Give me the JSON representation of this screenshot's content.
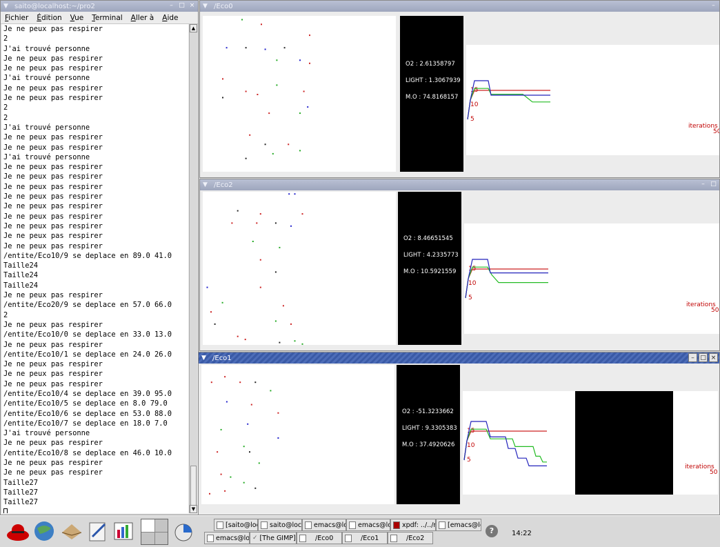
{
  "terminal": {
    "title": "saito@localhost:~/pro2",
    "menu": [
      "Fichier",
      "Édition",
      "Vue",
      "Terminal",
      "Aller à",
      "Aide"
    ],
    "lines": [
      "Je ne peux pas respirer",
      "2",
      "J'ai trouvé personne",
      "Je ne peux pas respirer",
      "Je ne peux pas respirer",
      "J'ai trouvé personne",
      "Je ne peux pas respirer",
      "Je ne peux pas respirer",
      "2",
      "2",
      "J'ai trouvé personne",
      "Je ne peux pas respirer",
      "Je ne peux pas respirer",
      "J'ai trouvé personne",
      "Je ne peux pas respirer",
      "Je ne peux pas respirer",
      "Je ne peux pas respirer",
      "Je ne peux pas respirer",
      "Je ne peux pas respirer",
      "Je ne peux pas respirer",
      "Je ne peux pas respirer",
      "Je ne peux pas respirer",
      "Je ne peux pas respirer",
      "/entite/Eco10/9 se deplace en 89.0 41.0",
      "Taille24",
      "Taille24",
      "Taille24",
      "Je ne peux pas respirer",
      "/entite/Eco20/9 se deplace en 57.0 66.0",
      "2",
      "Je ne peux pas respirer",
      "/entite/Eco10/0 se deplace en 33.0 13.0",
      "Je ne peux pas respirer",
      "/entite/Eco10/1 se deplace en 24.0 26.0",
      "Je ne peux pas respirer",
      "Je ne peux pas respirer",
      "Je ne peux pas respirer",
      "/entite/Eco10/4 se deplace en 39.0 95.0",
      "/entite/Eco10/5 se deplace en 8.0 79.0",
      "/entite/Eco10/6 se deplace en 53.0 88.0",
      "/entite/Eco10/7 se deplace en 18.0 7.0",
      "J'ai trouvé personne",
      "Je ne peux pas respirer",
      "/entite/Eco10/8 se deplace en 46.0 10.0",
      "Je ne peux pas respirer",
      "Je ne peux pas respirer",
      "Taille27",
      "Taille27",
      "Taille27"
    ]
  },
  "eco_windows": [
    {
      "id": "eco0",
      "title": "/Eco0",
      "active": false,
      "readout": [
        "O2 : 2.61358797",
        "LIGHT : 1.3067939",
        "M.O : 74.8168157"
      ],
      "y_ticks": [
        "15",
        "10",
        "5"
      ],
      "x_label": "iterations",
      "x_end": "50",
      "dots": [
        [
          0.2,
          0.02,
          "#22aa22"
        ],
        [
          0.3,
          0.05,
          "#cc2222"
        ],
        [
          0.55,
          0.12,
          "#cc2222"
        ],
        [
          0.12,
          0.2,
          "#2222cc"
        ],
        [
          0.22,
          0.2,
          "#222222"
        ],
        [
          0.32,
          0.21,
          "#2222cc"
        ],
        [
          0.42,
          0.2,
          "#222222"
        ],
        [
          0.5,
          0.28,
          "#2222cc"
        ],
        [
          0.38,
          0.28,
          "#22aa22"
        ],
        [
          0.55,
          0.3,
          "#cc2222"
        ],
        [
          0.1,
          0.4,
          "#cc2222"
        ],
        [
          0.22,
          0.48,
          "#cc2222"
        ],
        [
          0.28,
          0.5,
          "#cc2222"
        ],
        [
          0.38,
          0.44,
          "#22aa22"
        ],
        [
          0.52,
          0.48,
          "#cc2222"
        ],
        [
          0.1,
          0.52,
          "#222222"
        ],
        [
          0.34,
          0.62,
          "#cc2222"
        ],
        [
          0.5,
          0.62,
          "#22aa22"
        ],
        [
          0.54,
          0.58,
          "#2222cc"
        ],
        [
          0.24,
          0.76,
          "#cc2222"
        ],
        [
          0.32,
          0.82,
          "#222222"
        ],
        [
          0.44,
          0.82,
          "#cc2222"
        ],
        [
          0.5,
          0.86,
          "#22aa22"
        ],
        [
          0.22,
          0.91,
          "#222222"
        ],
        [
          0.36,
          0.88,
          "#22aa22"
        ]
      ]
    },
    {
      "id": "eco2",
      "title": "/Eco2",
      "active": false,
      "readout": [
        "O2 : 8.46651545",
        "LIGHT : 4.2335773",
        "M.O : 10.5921559"
      ],
      "y_ticks": [
        "15",
        "10",
        "5"
      ],
      "x_label": "iterations",
      "x_end": "50",
      "dots": [
        [
          0.45,
          0.01,
          "#2222cc"
        ],
        [
          0.48,
          0.01,
          "#2222cc"
        ],
        [
          0.18,
          0.12,
          "#222222"
        ],
        [
          0.3,
          0.14,
          "#cc2222"
        ],
        [
          0.52,
          0.14,
          "#cc2222"
        ],
        [
          0.15,
          0.2,
          "#cc2222"
        ],
        [
          0.28,
          0.2,
          "#cc2222"
        ],
        [
          0.38,
          0.2,
          "#222222"
        ],
        [
          0.46,
          0.22,
          "#2222cc"
        ],
        [
          0.26,
          0.32,
          "#22aa22"
        ],
        [
          0.4,
          0.36,
          "#22aa22"
        ],
        [
          0.3,
          0.44,
          "#cc2222"
        ],
        [
          0.38,
          0.52,
          "#222222"
        ],
        [
          0.02,
          0.62,
          "#2222cc"
        ],
        [
          0.3,
          0.62,
          "#cc2222"
        ],
        [
          0.1,
          0.72,
          "#22aa22"
        ],
        [
          0.42,
          0.74,
          "#cc2222"
        ],
        [
          0.04,
          0.78,
          "#cc2222"
        ],
        [
          0.38,
          0.84,
          "#22aa22"
        ],
        [
          0.46,
          0.86,
          "#cc2222"
        ],
        [
          0.18,
          0.94,
          "#cc2222"
        ],
        [
          0.22,
          0.96,
          "#cc2222"
        ],
        [
          0.4,
          0.98,
          "#222222"
        ],
        [
          0.48,
          0.97,
          "#22aa22"
        ],
        [
          0.52,
          0.99,
          "#22aa22"
        ],
        [
          0.06,
          0.86,
          "#222222"
        ]
      ]
    },
    {
      "id": "eco1",
      "title": "/Eco1",
      "active": true,
      "readout": [
        "O2 : -51.3233662",
        "LIGHT : 9.3305383",
        "M.O : 37.4920626"
      ],
      "y_ticks": [
        "15",
        "10",
        "5"
      ],
      "x_label": "iterations",
      "x_end": "50",
      "dots": [
        [
          0.05,
          0.12,
          "#cc2222"
        ],
        [
          0.12,
          0.08,
          "#cc2222"
        ],
        [
          0.2,
          0.12,
          "#cc2222"
        ],
        [
          0.28,
          0.12,
          "#222222"
        ],
        [
          0.36,
          0.18,
          "#22aa22"
        ],
        [
          0.13,
          0.26,
          "#2222cc"
        ],
        [
          0.26,
          0.28,
          "#cc2222"
        ],
        [
          0.4,
          0.34,
          "#cc2222"
        ],
        [
          0.1,
          0.46,
          "#22aa22"
        ],
        [
          0.24,
          0.42,
          "#2222cc"
        ],
        [
          0.22,
          0.58,
          "#22aa22"
        ],
        [
          0.4,
          0.52,
          "#2222cc"
        ],
        [
          0.08,
          0.62,
          "#cc2222"
        ],
        [
          0.25,
          0.62,
          "#222222"
        ],
        [
          0.1,
          0.78,
          "#cc2222"
        ],
        [
          0.15,
          0.8,
          "#22aa22"
        ],
        [
          0.22,
          0.84,
          "#22aa22"
        ],
        [
          0.12,
          0.9,
          "#cc2222"
        ],
        [
          0.28,
          0.88,
          "#222222"
        ],
        [
          0.04,
          0.92,
          "#cc2222"
        ],
        [
          0.3,
          0.7,
          "#22aa22"
        ]
      ]
    }
  ],
  "graph_series": {
    "eco0": {
      "red": [
        [
          0,
          0
        ],
        [
          0.02,
          20
        ],
        [
          0.05,
          30
        ],
        [
          0.3,
          30
        ],
        [
          0.6,
          30
        ]
      ],
      "blue": [
        [
          0,
          0
        ],
        [
          0.02,
          20
        ],
        [
          0.05,
          40
        ],
        [
          0.15,
          40
        ],
        [
          0.17,
          25
        ],
        [
          0.4,
          25
        ],
        [
          0.6,
          25
        ]
      ],
      "green": [
        [
          0,
          0
        ],
        [
          0.02,
          20
        ],
        [
          0.05,
          32
        ],
        [
          0.15,
          32
        ],
        [
          0.17,
          26
        ],
        [
          0.4,
          26
        ],
        [
          0.47,
          18
        ],
        [
          0.6,
          18
        ]
      ]
    },
    "eco2": {
      "red": [
        [
          0,
          0
        ],
        [
          0.02,
          20
        ],
        [
          0.05,
          30
        ],
        [
          0.4,
          30
        ],
        [
          0.6,
          30
        ]
      ],
      "blue": [
        [
          0,
          0
        ],
        [
          0.02,
          20
        ],
        [
          0.05,
          40
        ],
        [
          0.16,
          40
        ],
        [
          0.18,
          26
        ],
        [
          0.6,
          26
        ]
      ],
      "green": [
        [
          0,
          0
        ],
        [
          0.02,
          20
        ],
        [
          0.05,
          32
        ],
        [
          0.16,
          32
        ],
        [
          0.19,
          24
        ],
        [
          0.24,
          16
        ],
        [
          0.6,
          16
        ]
      ]
    },
    "eco1": {
      "red": [
        [
          0,
          0
        ],
        [
          0.02,
          20
        ],
        [
          0.05,
          30
        ],
        [
          0.35,
          30
        ],
        [
          0.6,
          30
        ]
      ],
      "blue": [
        [
          0,
          0
        ],
        [
          0.02,
          20
        ],
        [
          0.05,
          40
        ],
        [
          0.16,
          40
        ],
        [
          0.19,
          24
        ],
        [
          0.3,
          24
        ],
        [
          0.32,
          12
        ],
        [
          0.37,
          12
        ],
        [
          0.39,
          2
        ],
        [
          0.45,
          2
        ],
        [
          0.47,
          -6
        ],
        [
          0.6,
          -6
        ]
      ],
      "green": [
        [
          0,
          0
        ],
        [
          0.02,
          20
        ],
        [
          0.05,
          32
        ],
        [
          0.16,
          32
        ],
        [
          0.19,
          22
        ],
        [
          0.35,
          22
        ],
        [
          0.37,
          14
        ],
        [
          0.5,
          14
        ],
        [
          0.52,
          4
        ],
        [
          0.55,
          4
        ],
        [
          0.57,
          -2
        ],
        [
          0.6,
          -2
        ]
      ]
    }
  },
  "taskbar": {
    "row1": [
      "[saito@loca",
      "saito@local",
      "emacs@loc",
      "emacs@loc",
      "xpdf: ../../n",
      "[emacs@lo"
    ],
    "row2": [
      "emacs@loc",
      "[The GIMP]",
      "/Eco0",
      "/Eco1",
      "/Eco2"
    ],
    "clock": "14:22"
  }
}
